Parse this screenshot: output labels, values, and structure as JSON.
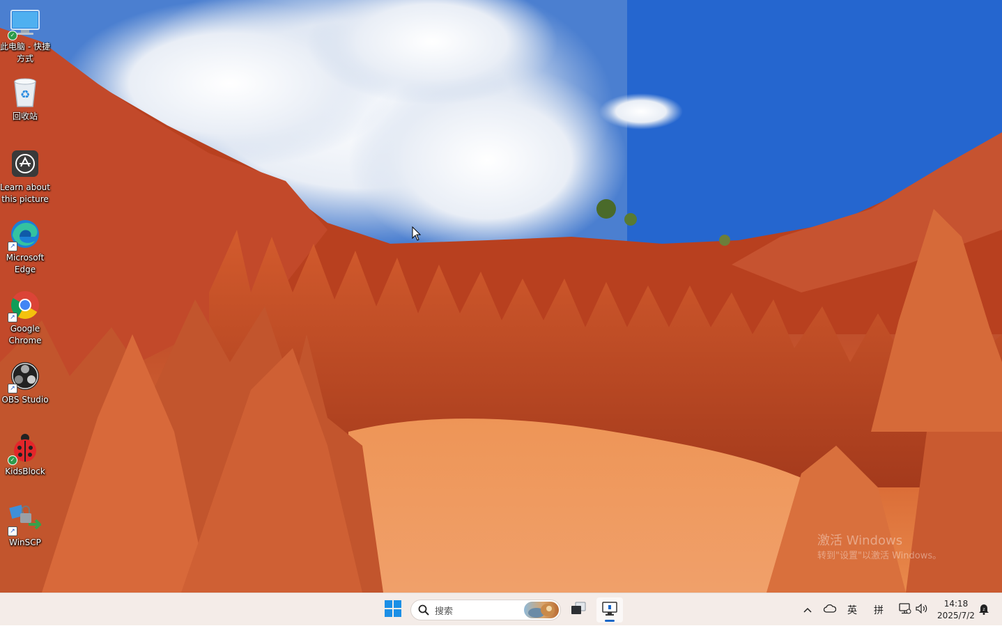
{
  "desktop": {
    "icons": [
      {
        "label": "此电脑 - 快捷方式",
        "icon": "monitor-icon"
      },
      {
        "label": "回收站",
        "icon": "recycle-bin-icon"
      },
      {
        "label": "Learn about this picture",
        "icon": "camera-icon"
      },
      {
        "label": "Microsoft Edge",
        "icon": "edge-icon"
      },
      {
        "label": "Google Chrome",
        "icon": "chrome-icon"
      },
      {
        "label": "OBS Studio",
        "icon": "obs-icon"
      },
      {
        "label": "KidsBlock",
        "icon": "ladybug-icon"
      },
      {
        "label": "WinSCP",
        "icon": "winscp-icon"
      }
    ],
    "watermark": {
      "title": "激活 Windows",
      "subtitle": "转到\"设置\"以激活 Windows。"
    }
  },
  "taskbar": {
    "search_placeholder": "搜索",
    "tray": {
      "input_lang": "英",
      "ime_mode": "拼",
      "time": "14:18",
      "date": "2025/7/2"
    }
  },
  "colors": {
    "taskbar_bg": "#f4ece8",
    "accent": "#1a66c7",
    "sky": "#2b71d8",
    "rock": "#c4532c"
  }
}
